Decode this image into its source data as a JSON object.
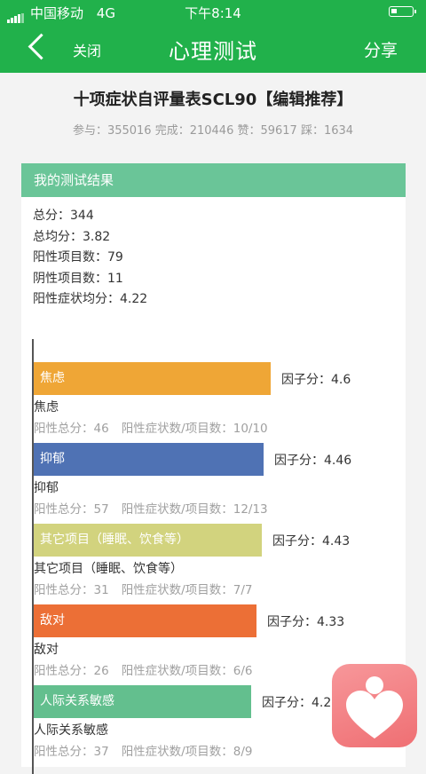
{
  "status_bar": {
    "carrier": "中国移动",
    "network": "4G",
    "time": "下午8:14",
    "battery_level": 0.3
  },
  "nav": {
    "back_icon": "chevron-left-icon",
    "close_label": "关闭",
    "title": "心理测试",
    "share_label": "分享"
  },
  "quiz": {
    "title": "十项症状自评量表SCL90【编辑推荐】",
    "stats": "参与：355016 完成：210446 赞：59617 踩：1634"
  },
  "result": {
    "header": "我的测试结果",
    "summary": [
      "总分：344",
      "总均分：3.82",
      "阳性项目数：79",
      "阴性项目数：11",
      "阳性症状均分：4.22"
    ]
  },
  "factors": [
    {
      "bar_label": "焦虑",
      "score_text": "因子分：4.6",
      "name": "焦虑",
      "pos_total": "阳性总分：46",
      "pos_ratio": "阳性症状数/项目数：10/10",
      "score": 4.6,
      "color": "#efa636"
    },
    {
      "bar_label": "抑郁",
      "score_text": "因子分：4.46",
      "name": "抑郁",
      "pos_total": "阳性总分：57",
      "pos_ratio": "阳性症状数/项目数：12/13",
      "score": 4.46,
      "color": "#4f72b4"
    },
    {
      "bar_label": "其它项目（睡眠、饮食等）",
      "score_text": "因子分：4.43",
      "name": "其它项目（睡眠、饮食等）",
      "pos_total": "阳性总分：31",
      "pos_ratio": "阳性症状数/项目数：7/7",
      "score": 4.43,
      "color": "#d2d37e"
    },
    {
      "bar_label": "敌对",
      "score_text": "因子分：4.33",
      "name": "敌对",
      "pos_total": "阳性总分：26",
      "pos_ratio": "阳性症状数/项目数：6/6",
      "score": 4.33,
      "color": "#ec6f36"
    },
    {
      "bar_label": "人际关系敏感",
      "score_text": "因子分：4.22",
      "name": "人际关系敏感",
      "pos_total": "阳性总分：37",
      "pos_ratio": "阳性症状数/项目数：8/9",
      "score": 4.22,
      "color": "#63bf8e"
    }
  ],
  "floating_app": {
    "icon": "heart-person-icon"
  }
}
